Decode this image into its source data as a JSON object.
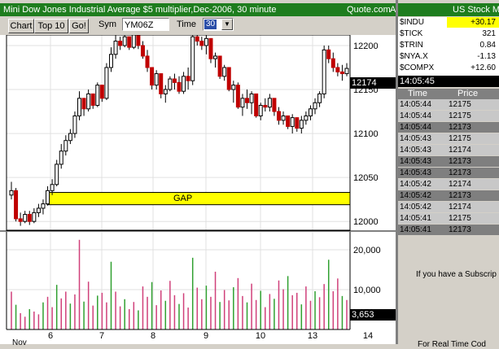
{
  "chart_window": {
    "title": "Mini Dow Jones Industrial Average $5 multiplier,Dec-2006, 30 minute",
    "source": "Quote.com",
    "source_suffix": "A",
    "toolbar": {
      "chart_label": "Chart",
      "top10_label": "Top 10",
      "go_label": "Go!",
      "sym_label": "Sym",
      "sym_value": "YM06Z",
      "time_label": "Time",
      "time_value": "30"
    },
    "current_price_badge": "12174",
    "current_volume_badge": "3,653",
    "gap_label": "GAP"
  },
  "chart_data": [
    {
      "type": "candlestick",
      "title": "",
      "x": [
        "6",
        "7",
        "8",
        "9",
        "10",
        "13",
        "14"
      ],
      "x_partial_label": "Nov",
      "y_ticks": [
        12000,
        12050,
        12100,
        12150,
        12200
      ],
      "ylim": [
        11990,
        12212
      ],
      "grid": true,
      "annotations": [
        {
          "text": "GAP",
          "y_low": 12019,
          "y_high": 12033
        }
      ],
      "last_price": 12174,
      "candles": [
        [
          12030,
          12045,
          12025,
          12035
        ],
        [
          12035,
          12038,
          12000,
          12003
        ],
        [
          12003,
          12010,
          11995,
          12000
        ],
        [
          12000,
          12012,
          11998,
          12008
        ],
        [
          12008,
          12012,
          11996,
          12000
        ],
        [
          12000,
          12015,
          11998,
          12010
        ],
        [
          12010,
          12020,
          12005,
          12015
        ],
        [
          12015,
          12025,
          12008,
          12020
        ],
        [
          12020,
          12040,
          12018,
          12035
        ],
        [
          12035,
          12048,
          12030,
          12042
        ],
        [
          12042,
          12070,
          12040,
          12065
        ],
        [
          12065,
          12088,
          12060,
          12080
        ],
        [
          12080,
          12098,
          12075,
          12092
        ],
        [
          12092,
          12105,
          12088,
          12100
        ],
        [
          12100,
          12125,
          12095,
          12120
        ],
        [
          12120,
          12148,
          12115,
          12140
        ],
        [
          12140,
          12138,
          12120,
          12128
        ],
        [
          12128,
          12150,
          12125,
          12145
        ],
        [
          12145,
          12140,
          12128,
          12132
        ],
        [
          12132,
          12158,
          12130,
          12155
        ],
        [
          12155,
          12152,
          12136,
          12140
        ],
        [
          12140,
          12180,
          12138,
          12175
        ],
        [
          12175,
          12198,
          12170,
          12190
        ],
        [
          12190,
          12212,
          12185,
          12205
        ],
        [
          12205,
          12210,
          12195,
          12200
        ],
        [
          12200,
          12215,
          12198,
          12210
        ],
        [
          12210,
          12206,
          12195,
          12198
        ],
        [
          12198,
          12215,
          12196,
          12212
        ],
        [
          12212,
          12210,
          12196,
          12200
        ],
        [
          12200,
          12205,
          12185,
          12188
        ],
        [
          12188,
          12195,
          12170,
          12175
        ],
        [
          12175,
          12172,
          12150,
          12155
        ],
        [
          12155,
          12172,
          12150,
          12168
        ],
        [
          12168,
          12165,
          12140,
          12145
        ],
        [
          12145,
          12155,
          12135,
          12150
        ],
        [
          12150,
          12165,
          12148,
          12162
        ],
        [
          12162,
          12168,
          12150,
          12158
        ],
        [
          12158,
          12165,
          12145,
          12148
        ],
        [
          12148,
          12170,
          12145,
          12165
        ],
        [
          12165,
          12175,
          12150,
          12160
        ],
        [
          12160,
          12215,
          12155,
          12210
        ],
        [
          12210,
          12215,
          12200,
          12205
        ],
        [
          12205,
          12210,
          12195,
          12200
        ],
        [
          12200,
          12212,
          12190,
          12208
        ],
        [
          12208,
          12205,
          12180,
          12185
        ],
        [
          12185,
          12192,
          12175,
          12188
        ],
        [
          12188,
          12185,
          12162,
          12165
        ],
        [
          12165,
          12178,
          12160,
          12175
        ],
        [
          12175,
          12170,
          12148,
          12150
        ],
        [
          12150,
          12160,
          12135,
          12155
        ],
        [
          12155,
          12158,
          12128,
          12130
        ],
        [
          12130,
          12145,
          12120,
          12140
        ],
        [
          12140,
          12150,
          12128,
          12135
        ],
        [
          12135,
          12148,
          12122,
          12145
        ],
        [
          12145,
          12142,
          12118,
          12120
        ],
        [
          12120,
          12135,
          12115,
          12132
        ],
        [
          12132,
          12140,
          12125,
          12130
        ],
        [
          12130,
          12145,
          12125,
          12140
        ],
        [
          12140,
          12138,
          12120,
          12125
        ],
        [
          12125,
          12130,
          12110,
          12115
        ],
        [
          12115,
          12125,
          12110,
          12120
        ],
        [
          12120,
          12118,
          12105,
          12108
        ],
        [
          12108,
          12122,
          12100,
          12118
        ],
        [
          12118,
          12115,
          12102,
          12106
        ],
        [
          12106,
          12120,
          12100,
          12115
        ],
        [
          12115,
          12125,
          12110,
          12120
        ],
        [
          12120,
          12132,
          12115,
          12128
        ],
        [
          12128,
          12140,
          12122,
          12135
        ],
        [
          12135,
          12148,
          12130,
          12145
        ],
        [
          12145,
          12200,
          12140,
          12195
        ],
        [
          12195,
          12200,
          12180,
          12185
        ],
        [
          12185,
          12192,
          12170,
          12175
        ],
        [
          12175,
          12180,
          12165,
          12170
        ],
        [
          12170,
          12178,
          12160,
          12168
        ],
        [
          12168,
          12180,
          12165,
          12174
        ]
      ]
    },
    {
      "type": "bar",
      "title": "",
      "y_ticks": [
        10000,
        20000
      ],
      "y_tick_labels": [
        "10,000",
        "20,000"
      ],
      "ylim": [
        0,
        24500
      ],
      "values": [
        9500,
        6200,
        4100,
        3200,
        5100,
        4500,
        3800,
        6800,
        8200,
        5600,
        11200,
        7800,
        9500,
        6500,
        8800,
        22500,
        7000,
        12000,
        6000,
        8500,
        9200,
        6800,
        17000,
        9500,
        5800,
        7600,
        5100,
        6900,
        4800,
        10800,
        8200,
        11900,
        6100,
        9800,
        7200,
        12200,
        8600,
        6400,
        9100,
        5500,
        18000,
        10500,
        7600,
        11000,
        8200,
        14500,
        6900,
        9900,
        7300,
        10600,
        12900,
        8400,
        6800,
        11500,
        7400,
        9700,
        5600,
        8900,
        7700,
        12300,
        10100,
        13400,
        8600,
        9200,
        6300,
        10800,
        7200,
        9600,
        8100,
        11400,
        17500,
        9600,
        12800,
        8400,
        7400
      ],
      "last_value": 3653
    }
  ],
  "quote_panel": {
    "title": "US Stock M",
    "quotes": [
      {
        "symbol": "$INDU",
        "value": "+30.17",
        "highlight": true
      },
      {
        "symbol": "$TICK",
        "value": "321",
        "highlight": false
      },
      {
        "symbol": "$TRIN",
        "value": "0.84",
        "highlight": false
      },
      {
        "symbol": "$NYA.X",
        "value": "-1.13",
        "highlight": false
      },
      {
        "symbol": "$COMPX",
        "value": "+12.60",
        "highlight": false
      }
    ],
    "current_time": "14:05:45",
    "tape_headers": {
      "time": "Time",
      "price": "Price"
    },
    "tape": [
      {
        "time": "14:05:44",
        "price": "12175",
        "shade": "light"
      },
      {
        "time": "14:05:44",
        "price": "12175",
        "shade": "light"
      },
      {
        "time": "14:05:44",
        "price": "12173",
        "shade": "dark"
      },
      {
        "time": "14:05:43",
        "price": "12175",
        "shade": "light"
      },
      {
        "time": "14:05:43",
        "price": "12174",
        "shade": "light"
      },
      {
        "time": "14:05:43",
        "price": "12173",
        "shade": "dark"
      },
      {
        "time": "14:05:43",
        "price": "12173",
        "shade": "dark"
      },
      {
        "time": "14:05:42",
        "price": "12174",
        "shade": "light"
      },
      {
        "time": "14:05:42",
        "price": "12173",
        "shade": "dark"
      },
      {
        "time": "14:05:42",
        "price": "12174",
        "shade": "light"
      },
      {
        "time": "14:05:41",
        "price": "12175",
        "shade": "light"
      },
      {
        "time": "14:05:41",
        "price": "12173",
        "shade": "dark"
      }
    ],
    "subscription_text": "If you have a Subscrip",
    "bottom_text": "For Real Time Cod"
  },
  "colors": {
    "title_green": "#1e7d1e",
    "candle_up": "#000000",
    "candle_down": "#c00000",
    "gap_fill": "#ffff00",
    "volume_a": "#d0407a",
    "volume_b": "#30a030",
    "tape_light": "#c8c8c8",
    "tape_dark": "#7f7f7f"
  }
}
